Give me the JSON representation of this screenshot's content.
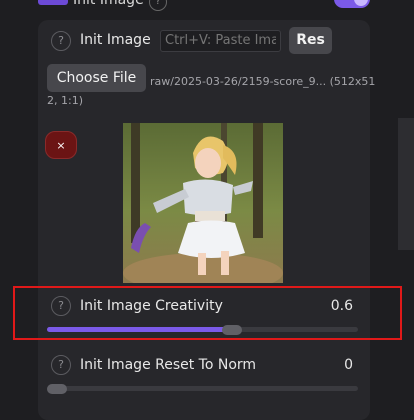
{
  "header": {
    "title": "Init Image",
    "help": "?"
  },
  "init_image": {
    "label": "Init Image",
    "help": "?",
    "paste_placeholder": "Ctrl+V: Paste Image",
    "res_label": "Res",
    "choose_file_label": "Choose File",
    "file_path_line1": "raw/2025-03-26/2159-score_9... (512x51",
    "file_path_line2": "2, 1:1)",
    "remove_label": "×"
  },
  "creativity": {
    "label": "Init Image Creativity",
    "help": "?",
    "value": "0.6",
    "slider_fraction": 0.6
  },
  "reset_to_norm": {
    "label": "Init Image Reset To Norm",
    "help": "?",
    "value": "0",
    "slider_fraction": 0
  },
  "colors": {
    "accent": "#7b5ae8",
    "highlight": "#e01919",
    "remove": "#6b1414"
  }
}
